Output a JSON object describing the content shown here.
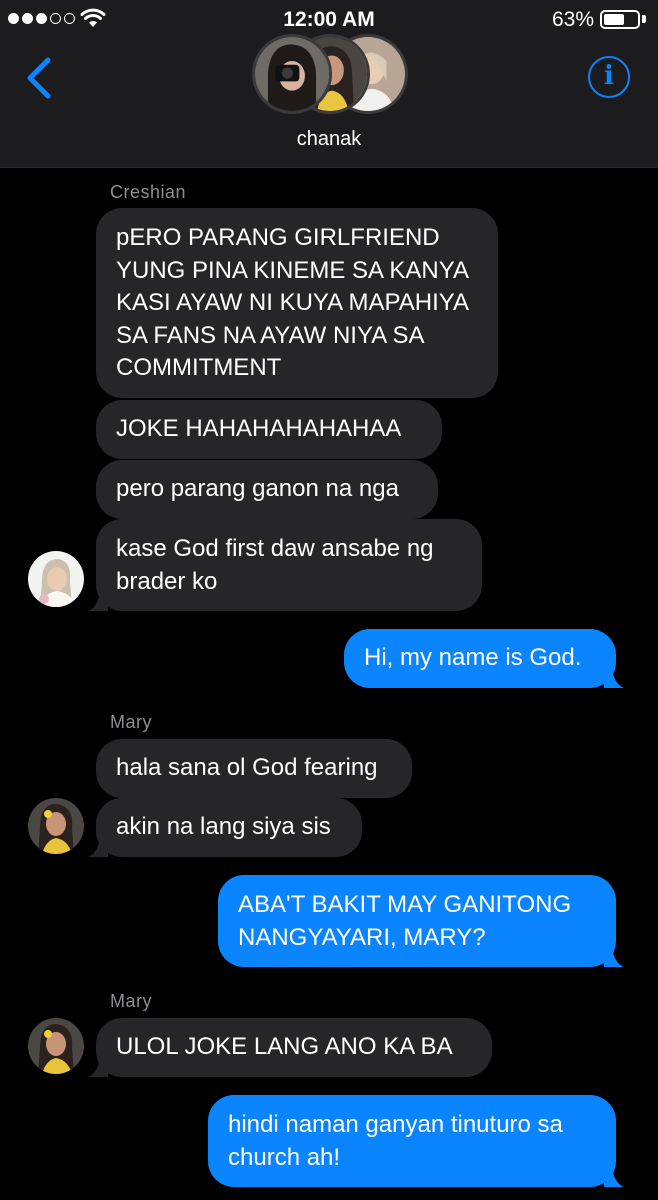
{
  "status_bar": {
    "time": "12:00 AM",
    "battery_percent": "63%",
    "battery_level": 0.63,
    "signal_bars_filled": 3,
    "signal_bars_total": 5
  },
  "header": {
    "group_name": "chanak",
    "back_icon": "chevron-left-icon",
    "info_icon": "info-icon",
    "info_glyph": "i",
    "accent_color": "#0a84ff"
  },
  "messages": [
    {
      "sender": "Creshian"
    },
    {
      "text": "pERO PARANG GIRLFRIEND YUNG PINA KINEME SA KANYA KASI AYAW NI KUYA MAPAHIYA SA FANS NA AYAW NIYA SA COMMITMENT"
    },
    {
      "text": "JOKE HAHAHAHAHAHAA"
    },
    {
      "text": "pero parang ganon na nga"
    },
    {
      "text": "kase God first daw ansabe ng brader ko"
    },
    {
      "text": "Hi, my name is God."
    },
    {
      "sender": "Mary"
    },
    {
      "text": "hala sana ol God fearing"
    },
    {
      "text": "akin na lang siya sis"
    },
    {
      "text": "ABA'T BAKIT MAY GANITONG NANGYAYARI, MARY?"
    },
    {
      "sender": "Mary"
    },
    {
      "text": "ULOL JOKE LANG ANO KA BA"
    },
    {
      "text": "hindi naman ganyan tinuturo sa church ah!"
    }
  ],
  "colors": {
    "received_bubble": "#262628",
    "sent_bubble": "#0a84ff",
    "background": "#000000",
    "header_background": "#1c1c1e"
  }
}
